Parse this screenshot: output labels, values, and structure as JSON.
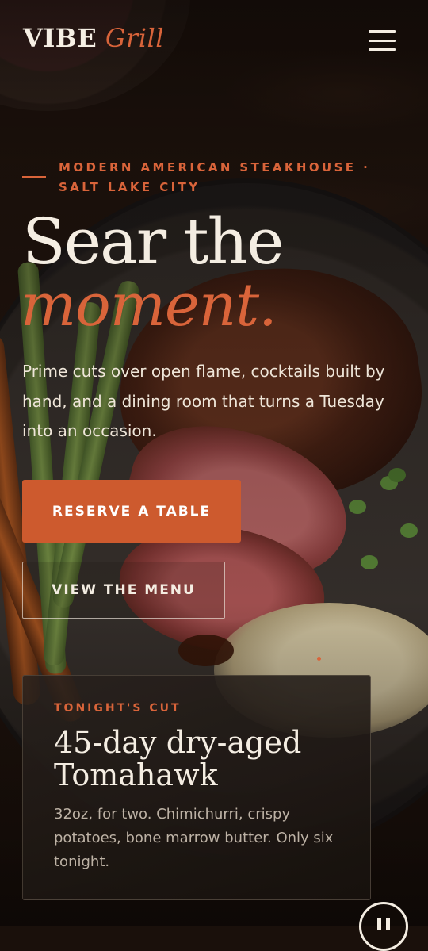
{
  "header": {
    "logo_primary": "VIBE",
    "logo_accent": "Grill",
    "menu_icon": "hamburger-icon"
  },
  "hero": {
    "eyebrow": "MODERN AMERICAN STEAKHOUSE · SALT LAKE CITY",
    "headline_line1": "Sear the",
    "headline_accent": "moment.",
    "lede": "Prime cuts over open flame, cocktails built by hand, and a dining room that turns a Tuesday into an occasion.",
    "primary_cta": "RESERVE A TABLE",
    "secondary_cta": "VIEW THE MENU"
  },
  "feature_card": {
    "eyebrow": "TONIGHT'S CUT",
    "title": "45-day dry-aged Tomahawk",
    "body": "32oz, for two. Chimichurri, crispy potatoes, bone marrow butter. Only six tonight."
  },
  "media_controls": {
    "pause_icon": "pause-icon"
  },
  "colors": {
    "accent": "#d9643a",
    "button": "#cd5a2e",
    "text_light": "#f4ede2",
    "card_text": "#bdb2a5"
  }
}
